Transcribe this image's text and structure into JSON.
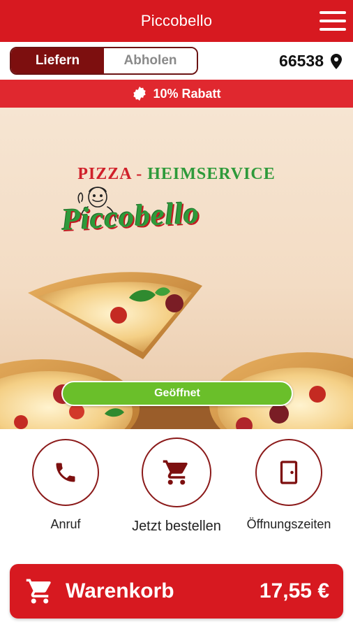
{
  "header": {
    "title": "Piccobello"
  },
  "mode": {
    "deliver_label": "Liefern",
    "pickup_label": "Abholen",
    "selected": "Liefern"
  },
  "location": {
    "zip": "66538"
  },
  "promo": {
    "text": "10% Rabatt"
  },
  "hero": {
    "headline_part1": "PIZZA",
    "headline_sep": " - ",
    "headline_part2": "HEIMSERVICE",
    "logo_script": "Piccobello",
    "status_label": "Geöffnet"
  },
  "actions": [
    {
      "label": "Anruf",
      "icon": "phone-icon"
    },
    {
      "label": "Jetzt bestellen",
      "icon": "cart-icon"
    },
    {
      "label": "Öffnungszeiten",
      "icon": "door-icon"
    }
  ],
  "cart": {
    "label": "Warenkorb",
    "total": "17,55 €"
  },
  "colors": {
    "primary": "#d71920",
    "dark_red": "#7d0f0f",
    "open_green": "#6abf2a",
    "logo_green": "#2e9a3a"
  }
}
